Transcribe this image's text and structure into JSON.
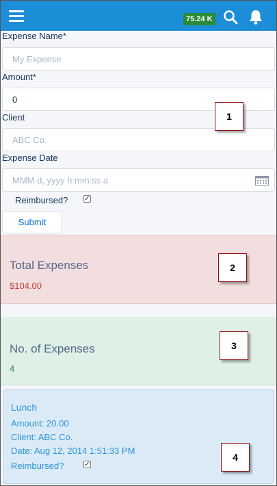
{
  "header": {
    "balance": "75.24 K"
  },
  "form": {
    "expense_name_label": "Expense Name*",
    "expense_name_placeholder": "My Expense",
    "amount_label": "Amount*",
    "amount_value": "0",
    "client_label": "Client",
    "client_placeholder": "ABC Co.",
    "date_label": "Expense Date",
    "date_placeholder": "MMM d, yyyy h:mm:ss a",
    "reimbursed_label": "Reimbursed?",
    "reimbursed_checked": true,
    "submit_label": "Submit"
  },
  "totals": {
    "title": "Total Expenses",
    "value": "$104.00"
  },
  "count": {
    "title": "No. of Expenses",
    "value": "4"
  },
  "expense_item": {
    "title": "Lunch",
    "amount": "Amount: 20.00",
    "client": "Client: ABC Co.",
    "date": "Date: Aug 12, 2014 1:51:33 PM",
    "reimbursed_label": "Reimbursed?",
    "reimbursed_checked": true
  },
  "callouts": [
    "1",
    "2",
    "3",
    "4"
  ],
  "colors": {
    "header": "#1c8ed8",
    "badge": "#2a8a3a",
    "total_card": "#f2dede",
    "count_card": "#dff0e6",
    "item_card": "#dbeaf7"
  },
  "icons": [
    "hamburger-menu-icon",
    "search-icon",
    "bell-icon",
    "calendar-icon",
    "checkmark-icon"
  ]
}
